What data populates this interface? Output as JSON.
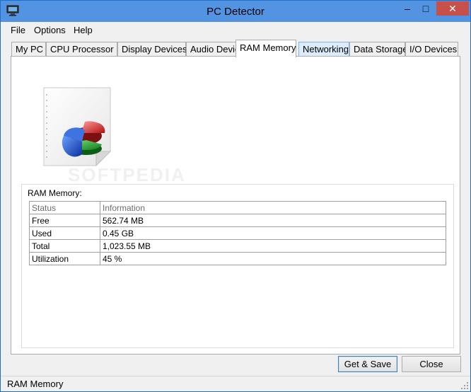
{
  "window": {
    "title": "PC Detector",
    "controls": {
      "minimize": "–",
      "maximize": "□",
      "close": "✕"
    }
  },
  "menu": {
    "items": [
      "File",
      "Options",
      "Help"
    ]
  },
  "tabs": [
    {
      "label": "My PC"
    },
    {
      "label": "CPU Processor"
    },
    {
      "label": "Display Devices"
    },
    {
      "label": "Audio Devices"
    },
    {
      "label": "RAM Memory"
    },
    {
      "label": "Networking"
    },
    {
      "label": "Data Storage"
    },
    {
      "label": "I/O Devices"
    }
  ],
  "active_tab": "RAM Memory",
  "hovered_tab": "Networking",
  "icon": {
    "name": "pie-chart-document-icon"
  },
  "ram": {
    "group_label": "RAM Memory:",
    "columns": [
      "Status",
      "Information"
    ],
    "rows": [
      [
        "Free",
        "562.74 MB"
      ],
      [
        "Used",
        "0.45 GB"
      ],
      [
        "Total",
        "1,023.55 MB"
      ],
      [
        "Utilization",
        "45 %"
      ]
    ]
  },
  "buttons": {
    "get_save": "Get & Save",
    "close": "Close"
  },
  "status": {
    "text": "RAM Memory"
  },
  "watermark": "SOFTPEDIA",
  "colors": {
    "titlebar": "#5294e2",
    "close_button": "#c7504a",
    "accent_border": "#3c7fb1"
  }
}
